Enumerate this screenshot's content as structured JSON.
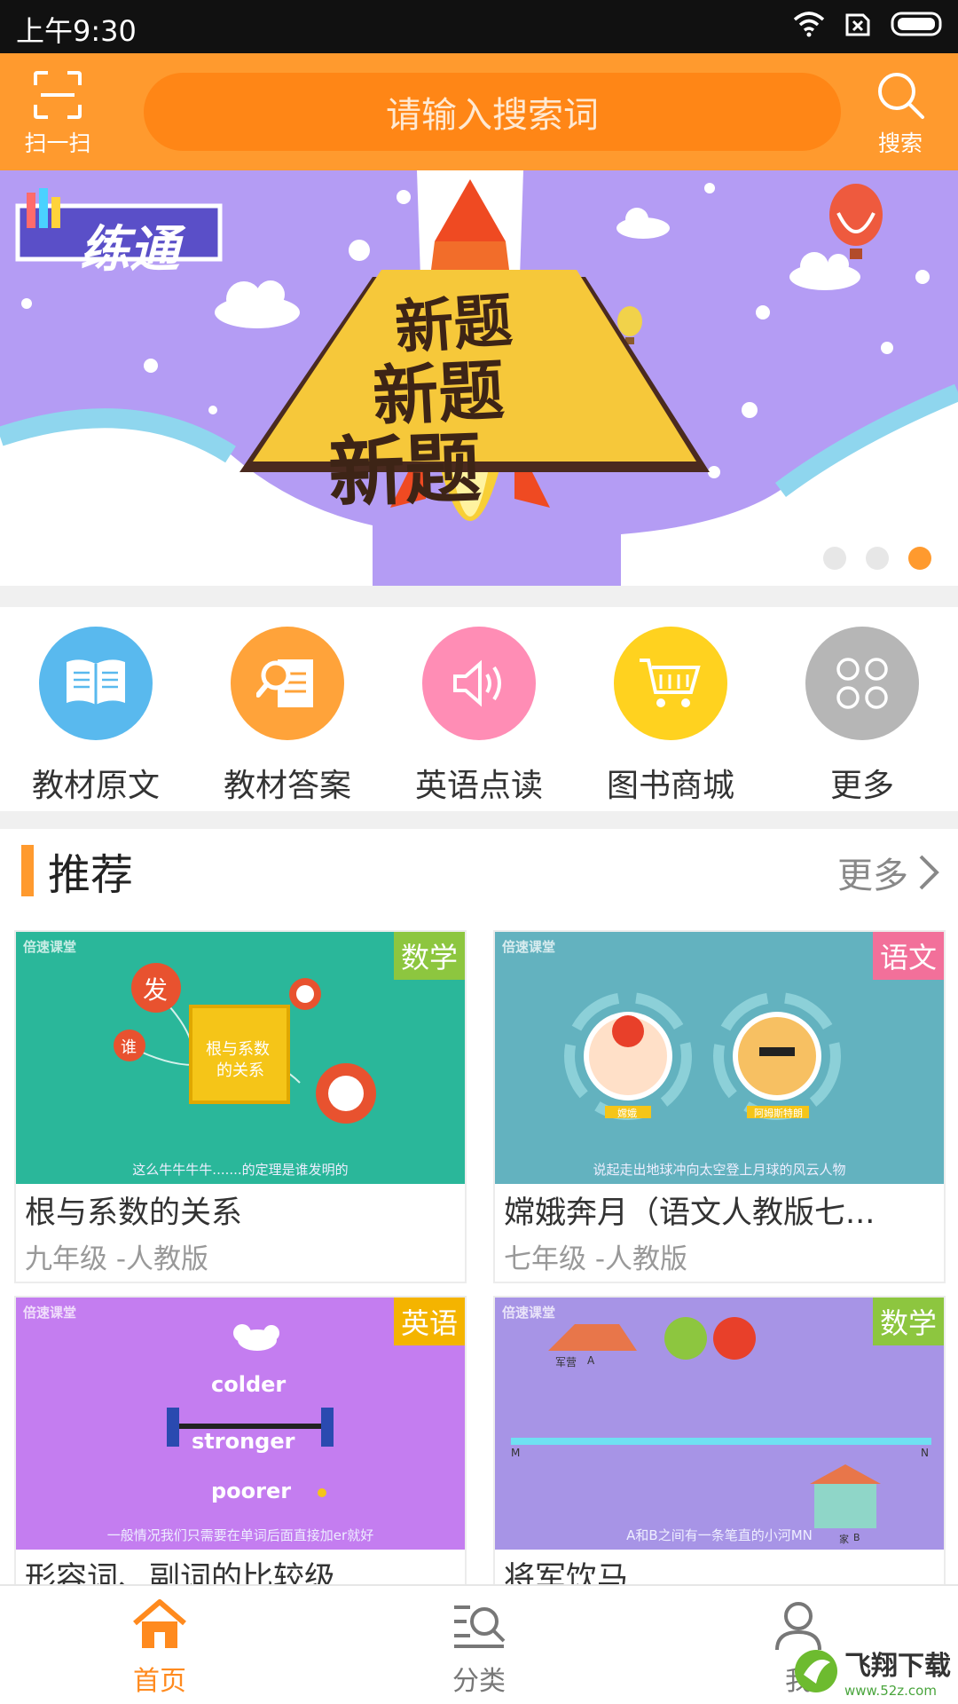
{
  "status": {
    "time": "上午9:30"
  },
  "header": {
    "scan_label": "扫一扫",
    "search_placeholder": "请输入搜索词",
    "search_label": "搜索"
  },
  "banner": {
    "logo_text": "练通",
    "headline": "新题",
    "page_count": 3,
    "active_page": 3
  },
  "quick_menu": [
    {
      "label": "教材原文",
      "icon": "book-icon",
      "color": "#59b9ee"
    },
    {
      "label": "教材答案",
      "icon": "answer-doc-icon",
      "color": "#ffa33a"
    },
    {
      "label": "英语点读",
      "icon": "speaker-icon",
      "color": "#ff8db5"
    },
    {
      "label": "图书商城",
      "icon": "cart-icon",
      "color": "#ffd21f"
    },
    {
      "label": "更多",
      "icon": "more-grid-icon",
      "color": "#b6b6b6"
    }
  ],
  "recommend": {
    "title": "推荐",
    "more_label": "更多",
    "items": [
      {
        "title": "根与系数的关系",
        "subtitle": "九年级 -人教版",
        "tag": "数学",
        "tag_color": "#8dc63f",
        "bg": "#2ab79a",
        "caption": "这么牛牛牛牛.......的定理是谁发明的",
        "logo": "倍速课堂",
        "thumb_words": [
          "根与系数",
          "的关系",
          "发",
          "谁"
        ]
      },
      {
        "title": "嫦娥奔月（语文人教版七...",
        "subtitle": "七年级 -人教版",
        "tag": "语文",
        "tag_color": "#f2709a",
        "bg": "#63b2bf",
        "caption": "说起走出地球冲向太空登上月球的风云人物",
        "logo": "倍速课堂",
        "thumb_words": [
          "嫦娥",
          "阿姆斯特朗"
        ]
      },
      {
        "title": "形容词、副词的比较级",
        "subtitle": "",
        "tag": "英语",
        "tag_color": "#f4b400",
        "bg": "#c47df0",
        "caption": "一般情况我们只需要在单词后面直接加er就好",
        "logo": "倍速课堂",
        "thumb_words": [
          "colder",
          "stronger",
          "poorer"
        ]
      },
      {
        "title": "将军饮马",
        "subtitle": "",
        "tag": "数学",
        "tag_color": "#8dc63f",
        "bg": "#a794e6",
        "caption": "A和B之间有一条笔直的小河MN",
        "logo": "倍速课堂",
        "thumb_words": [
          "军营",
          "A",
          "M",
          "N",
          "家",
          "B"
        ]
      }
    ]
  },
  "tabs": [
    {
      "label": "首页",
      "icon": "home-icon",
      "active": true
    },
    {
      "label": "分类",
      "icon": "category-search-icon",
      "active": false
    },
    {
      "label": "我",
      "icon": "user-icon",
      "active": false
    }
  ],
  "watermark": {
    "text": "飞翔下载",
    "url": "www.52z.com"
  },
  "colors": {
    "accent": "#ff9a2e",
    "accent_dark": "#ff8616"
  }
}
